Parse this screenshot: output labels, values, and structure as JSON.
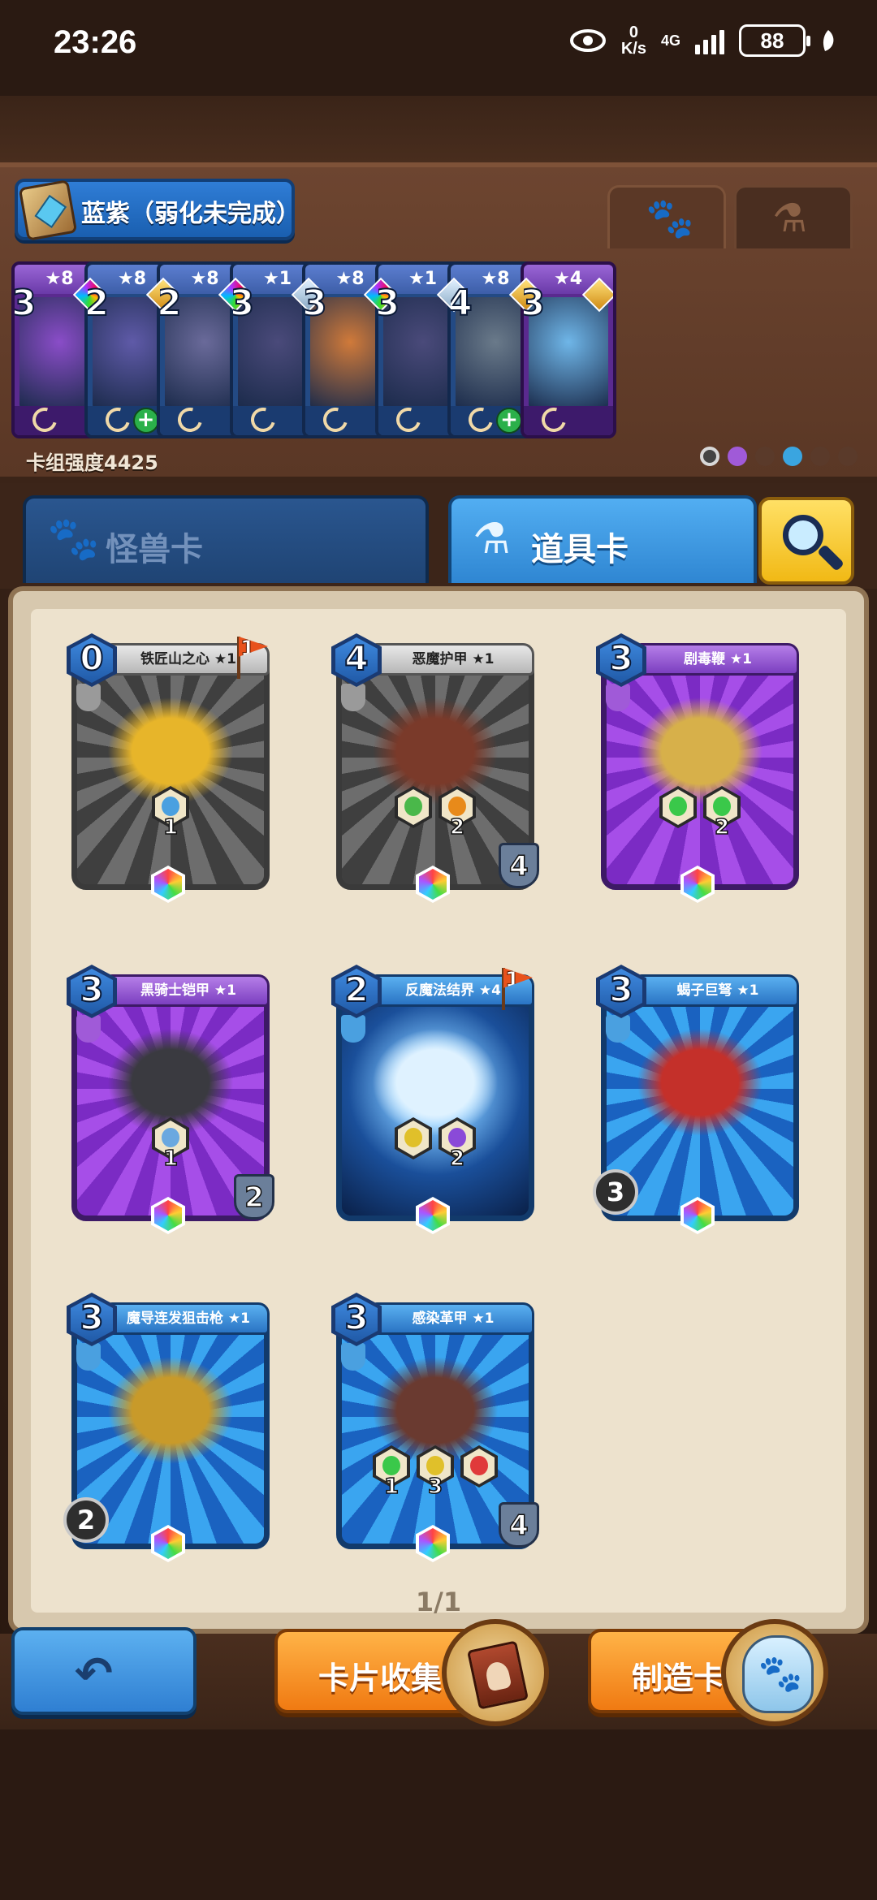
{
  "status_bar": {
    "time": "23:26",
    "net_speed_value": "0",
    "net_speed_unit": "K/s",
    "signal_label": "4G",
    "battery": "88"
  },
  "deck": {
    "name": "蓝紫（弱化未完成）",
    "power": "卡组强度4425",
    "cards": [
      {
        "stars": "★8",
        "cost": "3",
        "gem": "rainbow",
        "style": "purple",
        "art": "#8a4dc8",
        "plus": false
      },
      {
        "stars": "★8",
        "cost": "2",
        "gem": "gold",
        "style": "blue",
        "art": "#5f5aa8",
        "plus": true
      },
      {
        "stars": "★8",
        "cost": "2",
        "gem": "rainbow",
        "style": "blue",
        "art": "#6a6a9a",
        "plus": false
      },
      {
        "stars": "★1",
        "cost": "3",
        "gem": "silver",
        "style": "blue",
        "art": "#4a4a7a",
        "plus": false
      },
      {
        "stars": "★8",
        "cost": "3",
        "gem": "rainbow",
        "style": "blue",
        "art": "#d07a3a",
        "plus": false
      },
      {
        "stars": "★1",
        "cost": "3",
        "gem": "silver",
        "style": "blue",
        "art": "#4a4a7a",
        "plus": false
      },
      {
        "stars": "★8",
        "cost": "4",
        "gem": "gold",
        "style": "blue",
        "art": "#6a7a8a",
        "plus": true
      },
      {
        "stars": "★4",
        "cost": "3",
        "gem": "gold",
        "style": "purple",
        "art": "#6fb6e8",
        "plus": false
      }
    ]
  },
  "tabs": {
    "monster": "怪兽卡",
    "item": "道具卡"
  },
  "items": [
    {
      "name": "铁匠山之心 ★1",
      "cost": "0",
      "style": "grey",
      "cls": "#9a9a9a",
      "flag": "1",
      "art": "#e7b52a",
      "hexes": [
        {
          "color": "#4aa0e0",
          "num": "1"
        }
      ],
      "shield": "",
      "durability": ""
    },
    {
      "name": "恶魔护甲 ★1",
      "cost": "4",
      "style": "grey",
      "cls": "#9a9a9a",
      "flag": "",
      "art": "#7a3a2a",
      "hexes": [
        {
          "color": "#4ab84a",
          "num": ""
        },
        {
          "color": "#e88a1a",
          "num": "2"
        }
      ],
      "shield": "4",
      "durability": ""
    },
    {
      "name": "剧毒鞭 ★1",
      "cost": "3",
      "style": "purple",
      "cls": "#a05ad8",
      "flag": "",
      "art": "#d7b04a",
      "hexes": [
        {
          "color": "#3ac84a",
          "num": ""
        },
        {
          "color": "#3ac84a",
          "num": "2"
        }
      ],
      "shield": "",
      "durability": ""
    },
    {
      "name": "黑骑士铠甲 ★1",
      "cost": "3",
      "style": "purple",
      "cls": "#a05ad8",
      "flag": "",
      "art": "#3a3a40",
      "hexes": [
        {
          "color": "#6aa8e0",
          "num": "1"
        }
      ],
      "shield": "2",
      "durability": ""
    },
    {
      "name": "反魔法结界 ★4",
      "cost": "2",
      "style": "dark",
      "cls": "#4aa0e0",
      "flag": "1",
      "art": "#dff2ff",
      "hexes": [
        {
          "color": "#e0c02a",
          "num": ""
        },
        {
          "color": "#8a4ad8",
          "num": "2"
        }
      ],
      "shield": "",
      "durability": ""
    },
    {
      "name": "蝎子巨弩 ★1",
      "cost": "3",
      "style": "blue",
      "cls": "#4aa0e0",
      "flag": "",
      "art": "#c4302a",
      "hexes": [],
      "shield": "",
      "durability": "3"
    },
    {
      "name": "魔导连发狙击枪 ★1",
      "cost": "3",
      "style": "blue",
      "cls": "#4aa0e0",
      "flag": "",
      "art": "#c89a2a",
      "hexes": [],
      "shield": "",
      "durability": "2"
    },
    {
      "name": "感染革甲 ★1",
      "cost": "3",
      "style": "blue",
      "cls": "#4aa0e0",
      "flag": "",
      "art": "#6a3a30",
      "hexes": [
        {
          "color": "#3ac84a",
          "num": "1"
        },
        {
          "color": "#e0c02a",
          "num": "3"
        },
        {
          "color": "#e03a3a",
          "num": ""
        }
      ],
      "shield": "4",
      "durability": ""
    }
  ],
  "pager": "1/1",
  "bottom": {
    "collect": "卡片收集",
    "craft": "制造卡片"
  },
  "icons": {
    "paw": "🐾",
    "potion": "⚗",
    "back": "↶"
  },
  "colors": {
    "accent_blue": "#2f86d2",
    "accent_orange": "#f07a12",
    "search_yellow": "#f1b915"
  }
}
